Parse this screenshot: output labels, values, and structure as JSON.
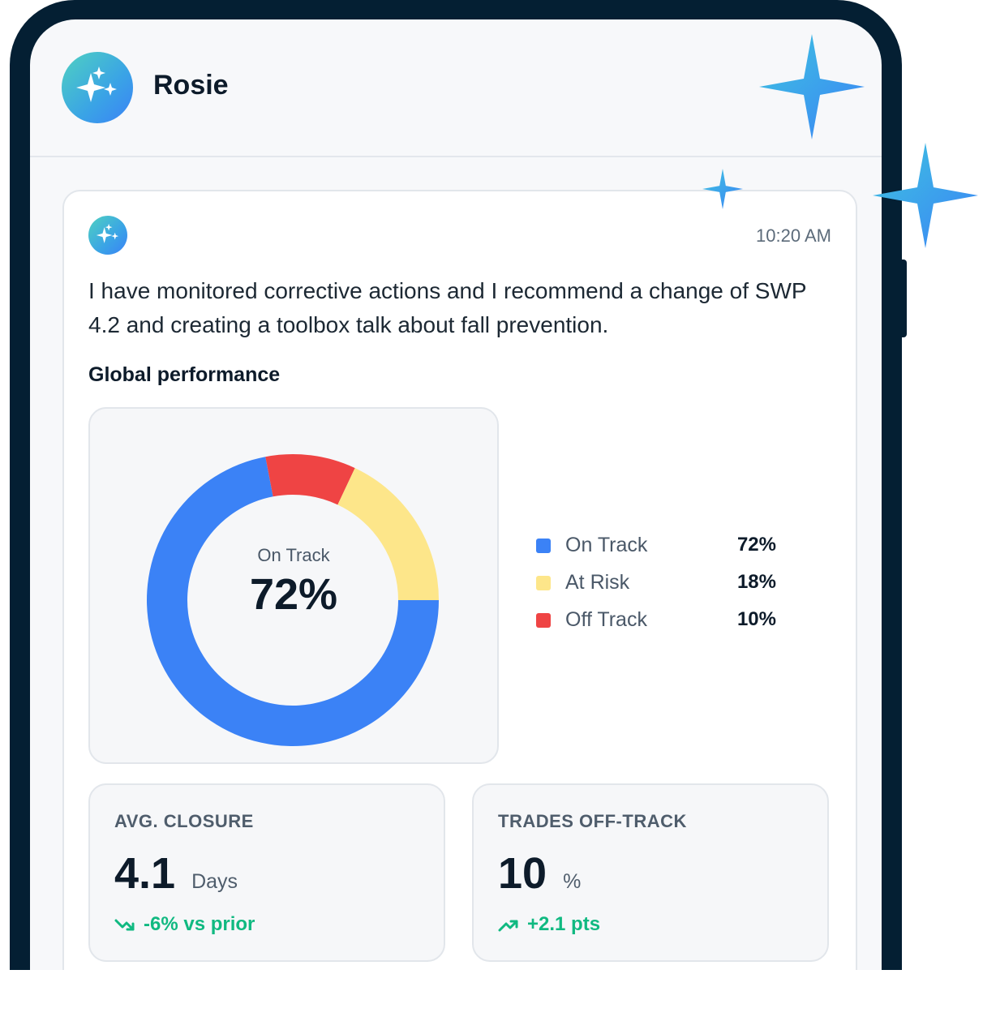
{
  "app": {
    "title": "Rosie"
  },
  "message": {
    "time": "10:20 AM",
    "text": "I have monitored corrective actions and I recommend a change of SWP 4.2 and creating a toolbox talk about fall prevention."
  },
  "performance": {
    "heading": "Global performance",
    "center_label": "On Track",
    "center_value": "72%",
    "legend": [
      {
        "label": "On Track",
        "value": "72%",
        "color": "#3b82f6"
      },
      {
        "label": "At Risk",
        "value": "18%",
        "color": "#fde68a"
      },
      {
        "label": "Off Track",
        "value": "10%",
        "color": "#ef4444"
      }
    ]
  },
  "chart_data": {
    "type": "pie",
    "donut": true,
    "categories": [
      "On Track",
      "At Risk",
      "Off Track"
    ],
    "values": [
      72,
      18,
      10
    ],
    "colors": [
      "#3b82f6",
      "#fde68a",
      "#ef4444"
    ],
    "title": "Global performance"
  },
  "stats": [
    {
      "label": "AVG. CLOSURE",
      "value": "4.1",
      "unit": "Days",
      "delta": "-6% vs prior",
      "trend": "down"
    },
    {
      "label": "TRADES OFF-TRACK",
      "value": "10",
      "unit": "%",
      "delta": "+2.1 pts",
      "trend": "up"
    }
  ]
}
